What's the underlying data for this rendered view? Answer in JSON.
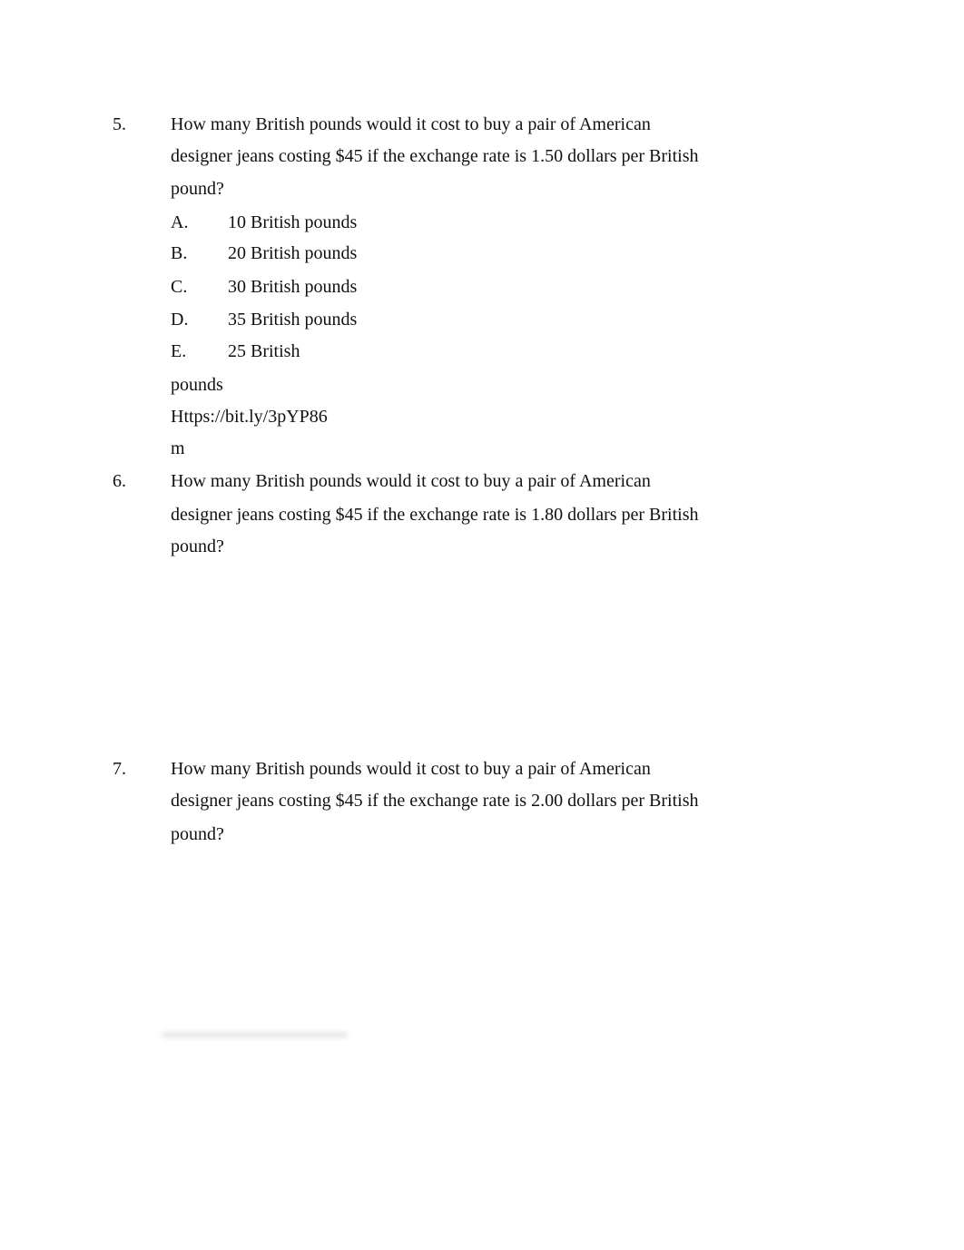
{
  "questions": [
    {
      "number": "5.",
      "lines": [
        "How many British pounds would it cost to buy a pair of American",
        "designer jeans costing $45 if the exchange rate is 1.50 dollars per British",
        "pound?"
      ],
      "options": [
        {
          "letter": "A.",
          "text": "10 British pounds"
        },
        {
          "letter": "B.",
          "text": "20 British pounds"
        },
        {
          "letter": "C.",
          "text": "30 British pounds"
        },
        {
          "letter": "D.",
          "text": "35 British pounds"
        },
        {
          "letter": "E.",
          "text": "25 British"
        }
      ],
      "trailing_lines": [
        "pounds",
        "Https://bit.ly/3pYP86",
        "m"
      ]
    },
    {
      "number": "6.",
      "lines": [
        "How many British pounds would it cost to buy a pair of American",
        "designer jeans costing $45 if the exchange rate is 1.80 dollars per British",
        "pound?"
      ]
    },
    {
      "number": "7.",
      "lines": [
        "How many British pounds would it cost to buy a pair of American",
        "designer jeans costing $45 if the exchange rate is 2.00 dollars per British",
        "pound?"
      ]
    }
  ]
}
